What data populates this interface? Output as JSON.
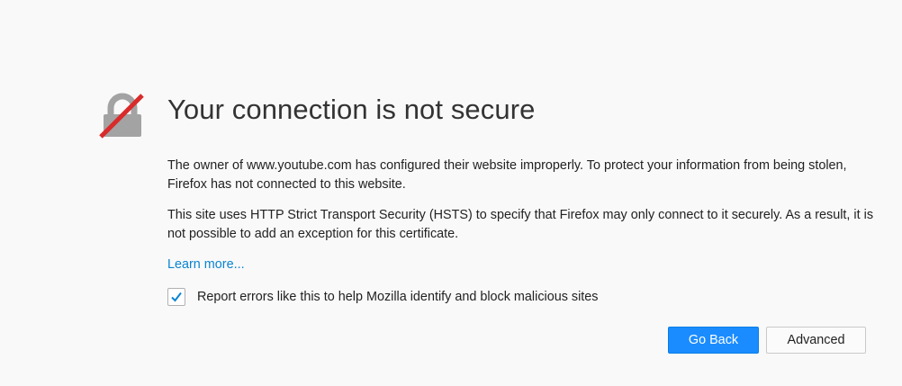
{
  "error_page": {
    "icon": "broken-lock-icon",
    "title": "Your connection is not secure",
    "paragraph1": "The owner of www.youtube.com has configured their website improperly. To protect your information from being stolen, Firefox has not connected to this website.",
    "paragraph2": "This site uses HTTP Strict Transport Security (HSTS) to specify that Firefox may only connect to it securely. As a result, it is not possible to add an exception for this certificate.",
    "learn_more": "Learn more...",
    "report_checkbox": {
      "checked": true,
      "label": "Report errors like this to help Mozilla identify and block malicious sites"
    },
    "buttons": {
      "go_back": "Go Back",
      "advanced": "Advanced"
    }
  },
  "colors": {
    "background": "#f9f9f9",
    "link": "#0a84d0",
    "primary_button": "#1a8cff",
    "lock_gray": "#a3a3a3",
    "slash_red": "#d92b2b",
    "check_blue": "#0a84d0"
  }
}
